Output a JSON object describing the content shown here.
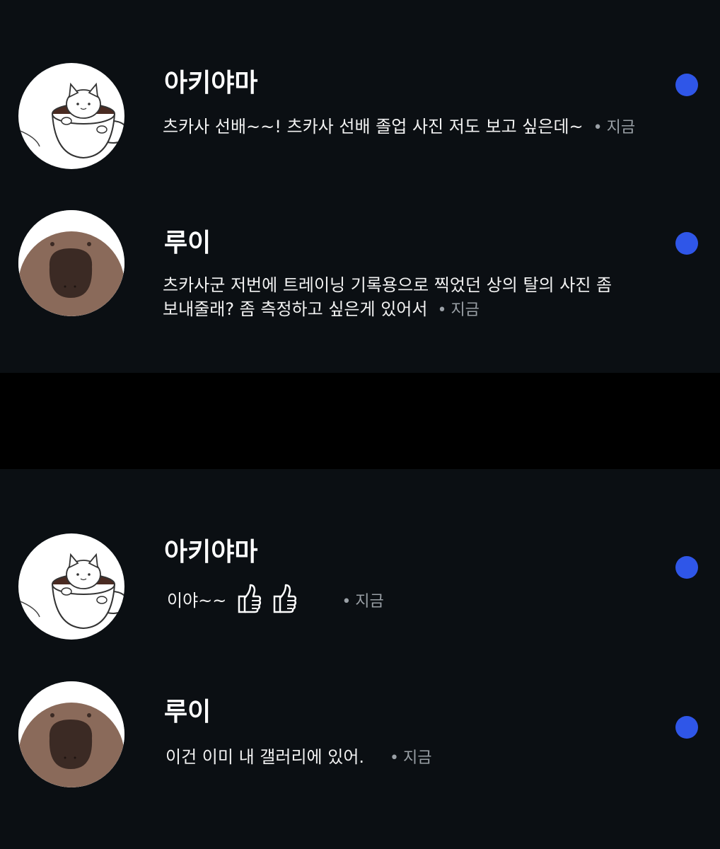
{
  "colors": {
    "panel_bg": "#0b0f13",
    "gap_bg": "#000000",
    "unread_dot": "#2f56e8",
    "meta_text": "#9aa0a6"
  },
  "top": {
    "rows": [
      {
        "name": "아키야마",
        "avatar_icon": "cat-in-cup-icon",
        "message": "츠카사 선배~~! 츠카사 선배 졸업 사진 저도 보고 싶은데~",
        "time": "지금",
        "unread": true
      },
      {
        "name": "루이",
        "avatar_icon": "platypus-icon",
        "message_line1": "츠카사군 저번에 트레이닝 기록용으로 찍었던 상의 탈의 사진 좀",
        "message_line2": "보내줄래? 좀 측정하고 싶은게 있어서",
        "time": "지금",
        "unread": true
      }
    ]
  },
  "bottom": {
    "rows": [
      {
        "name": "아키야마",
        "avatar_icon": "cat-in-cup-icon",
        "message": "이야~~",
        "emoji": "thumbs-up-icon",
        "time": "지금",
        "unread": true
      },
      {
        "name": "루이",
        "avatar_icon": "platypus-icon",
        "message": "이건 이미 내 갤러리에 있어.",
        "time": "지금",
        "unread": true
      }
    ]
  },
  "separator": "•"
}
